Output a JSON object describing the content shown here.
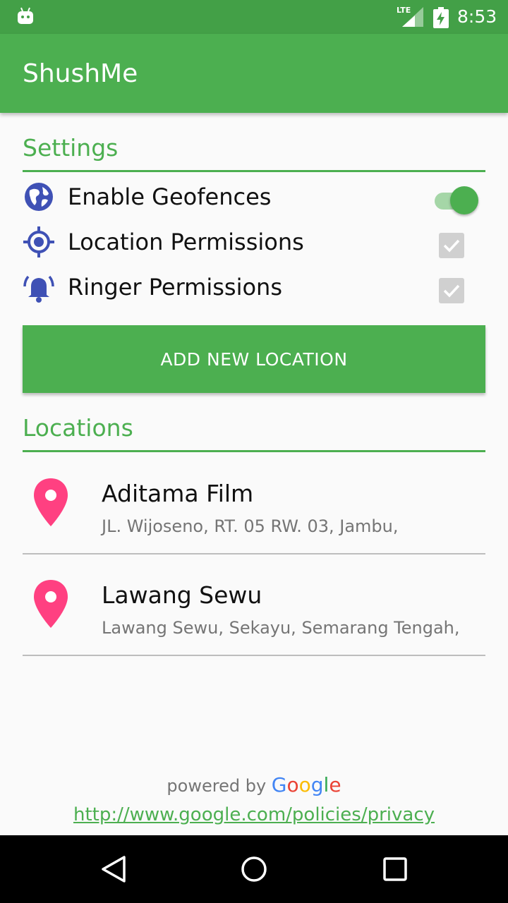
{
  "status_bar": {
    "network": "LTE",
    "time": "8:53"
  },
  "app_bar": {
    "title": "ShushMe"
  },
  "settings": {
    "title": "Settings",
    "items": [
      {
        "label": "Enable Geofences",
        "icon": "globe-icon",
        "control": "switch",
        "on": true
      },
      {
        "label": "Location Permissions",
        "icon": "gps-fixed-icon",
        "control": "checkbox",
        "checked": true
      },
      {
        "label": "Ringer Permissions",
        "icon": "ringer-bell-icon",
        "control": "checkbox",
        "checked": true
      }
    ]
  },
  "add_button": {
    "label": "ADD NEW LOCATION"
  },
  "locations": {
    "title": "Locations",
    "items": [
      {
        "name": "Aditama Film",
        "address": "JL. Wijoseno, RT. 05 RW. 03, Jambu,"
      },
      {
        "name": "Lawang Sewu",
        "address": "Lawang Sewu, Sekayu, Semarang Tengah,"
      }
    ]
  },
  "footer": {
    "powered_by": "powered by",
    "brand": "Google",
    "privacy_link": "http://www.google.com/policies/privacy"
  },
  "colors": {
    "primary": "#4caf50",
    "primary_dark": "#43a047",
    "icon_blue": "#3f51b5",
    "pin_pink": "#ff4081"
  }
}
